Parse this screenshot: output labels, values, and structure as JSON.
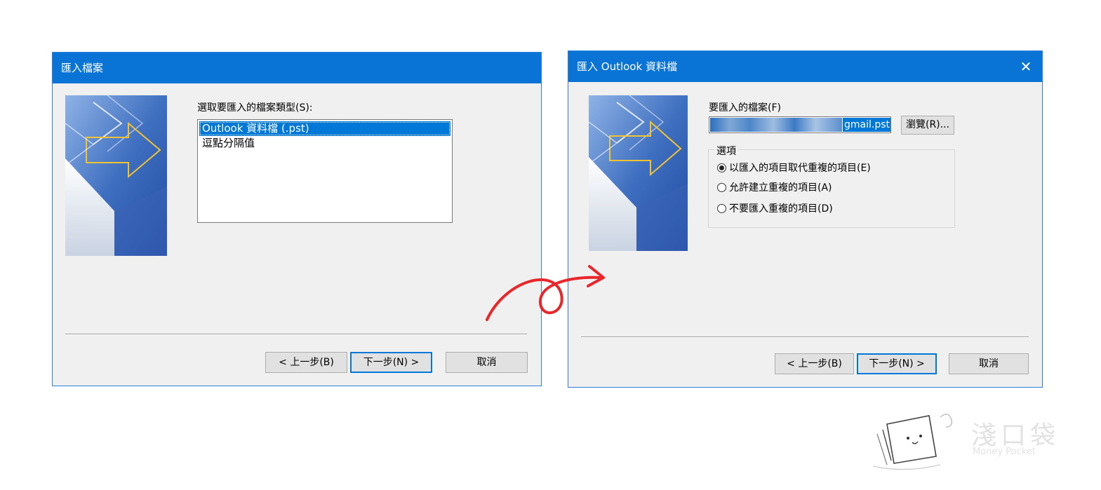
{
  "left_dialog": {
    "title": "匯入檔案",
    "prompt": "選取要匯入的檔案類型(S):",
    "list_items": [
      "Outlook 資料檔 (.pst)",
      "逗點分隔值"
    ],
    "selected_index": 0,
    "buttons": {
      "back": "< 上一步(B)",
      "next": "下一步(N) >",
      "cancel": "取消"
    }
  },
  "right_dialog": {
    "title": "匯入 Outlook 資料檔",
    "close_icon": "close-icon",
    "file_label": "要匯入的檔案(F)",
    "file_value": "gmail.pst",
    "browse_label": "瀏覽(R)...",
    "options_legend": "選項",
    "options": [
      {
        "label": "以匯入的項目取代重複的項目(E)",
        "checked": true
      },
      {
        "label": "允許建立重複的項目(A)",
        "checked": false
      },
      {
        "label": "不要匯入重複的項目(D)",
        "checked": false
      }
    ],
    "buttons": {
      "back": "< 上一步(B)",
      "next": "下一步(N) >",
      "cancel": "取消"
    }
  },
  "watermark": {
    "name": "淺口袋",
    "subtitle": "Money Pocket"
  },
  "colors": {
    "title_bar": "#0a74d6",
    "dialog_bg": "#f0f0f0",
    "selection": "#0078d7",
    "arrow": "#e8272a"
  }
}
